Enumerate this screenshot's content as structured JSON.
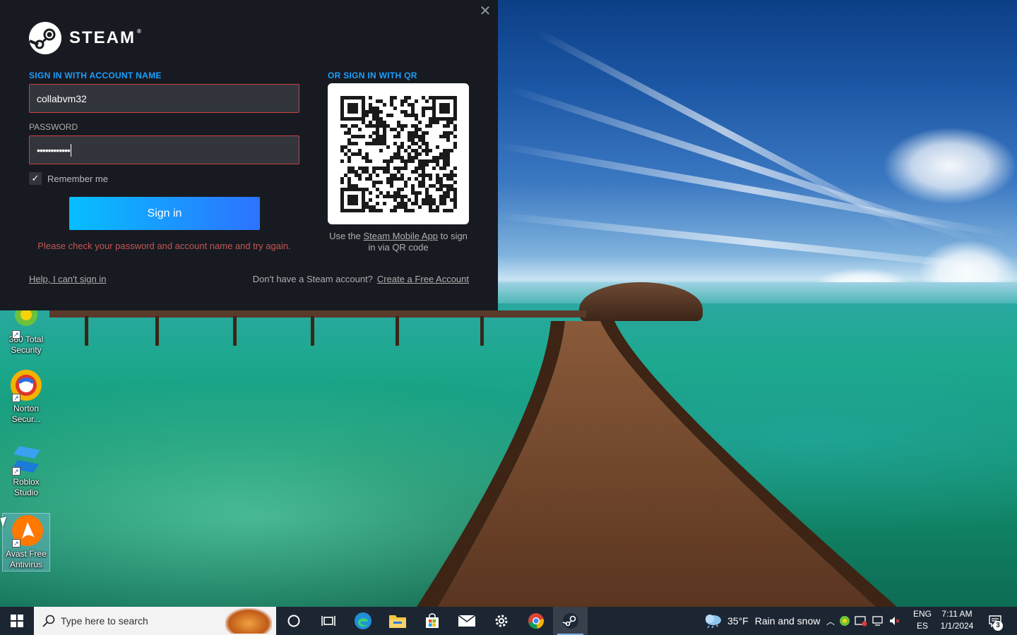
{
  "steam": {
    "brand": "STEAM",
    "trademark": "®",
    "close_glyph": "✕",
    "account_section_title": "SIGN IN WITH ACCOUNT NAME",
    "account_name_value": "collabvm32",
    "password_label": "PASSWORD",
    "password_value": "••••••••••••",
    "remember_label": "Remember me",
    "remember_checked": true,
    "signin_label": "Sign in",
    "error_message": "Please check your password and account name and try again.",
    "qr_section_title": "OR SIGN IN WITH QR",
    "qr_caption_prefix": "Use the ",
    "qr_caption_link": "Steam Mobile App",
    "qr_caption_suffix": " to sign in via QR code",
    "help_link": "Help, I can't sign in",
    "no_account_text": "Don't have a Steam account?",
    "create_account_link": "Create a Free Account",
    "accent_color": "#1a9fff",
    "error_color": "#c15755"
  },
  "desktop_icons": [
    {
      "label": "360 Total Security",
      "icon": "360-total-security-icon"
    },
    {
      "label": "Norton Secur...",
      "icon": "norton-security-icon"
    },
    {
      "label": "Roblox Studio",
      "icon": "roblox-studio-icon"
    },
    {
      "label": "Avast Free Antivirus",
      "icon": "avast-antivirus-icon"
    }
  ],
  "taskbar": {
    "search_placeholder": "Type here to search",
    "apps": [
      "cortana-icon",
      "task-view-icon",
      "edge-icon",
      "file-explorer-icon",
      "microsoft-store-icon",
      "mail-icon",
      "settings-icon",
      "chrome-icon",
      "steam-icon"
    ],
    "active_app": "steam-icon",
    "weather_temp": "35°F",
    "weather_desc": "Rain and snow",
    "lang_top": "ENG",
    "lang_bottom": "ES",
    "time": "7:11 AM",
    "date": "1/1/2024",
    "notification_count": "3"
  }
}
